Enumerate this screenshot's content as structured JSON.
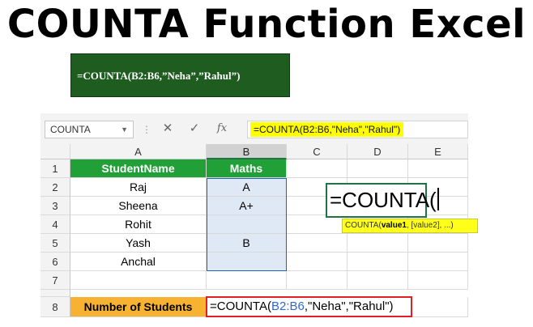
{
  "page_title": "COUNTA Function Excel",
  "green_banner": "=COUNTA(B2:B6,”Neha”,”Rahul”)",
  "formula_bar": {
    "name_box": "COUNTA",
    "formula": "=COUNTA(B2:B6,\"Neha\",\"Rahul\")",
    "cancel_icon": "close-icon",
    "enter_icon": "check-icon",
    "fx_label": "fx"
  },
  "columns": [
    "A",
    "B",
    "C",
    "D",
    "E"
  ],
  "rows": [
    "1",
    "2",
    "3",
    "4",
    "5",
    "6",
    "7",
    "8"
  ],
  "table": {
    "header_student": "StudentName",
    "header_maths": "Maths",
    "students": [
      "Raj",
      "Sheena",
      "Rohit",
      "Yash",
      "Anchal"
    ],
    "maths": [
      "A",
      "A+",
      "",
      "B",
      ""
    ]
  },
  "summary_label": "Number of Students",
  "editing_formula": {
    "prefix": "=COUNTA(",
    "ref": "B2:B6",
    "suffix": ",\"Neha\",\"Rahul\")"
  },
  "floating_cell_text": "=COUNTA(",
  "tooltip": {
    "fn": "COUNTA(",
    "arg1": "value1",
    "rest": ", [value2], ...)"
  },
  "colors": {
    "excel_green": "#217346",
    "header_green": "#21a038",
    "banner_green": "#1e5c20",
    "orange": "#f7b231",
    "highlight_yellow": "#ffff00",
    "edit_red": "#e02020",
    "ref_blue": "#2b6bd1"
  }
}
